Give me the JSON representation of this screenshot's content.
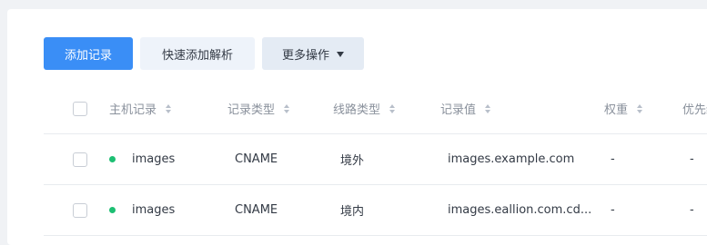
{
  "toolbar": {
    "add_label": "添加记录",
    "quick_add_label": "快速添加解析",
    "more_label": "更多操作"
  },
  "table": {
    "headers": {
      "host": "主机记录",
      "type": "记录类型",
      "line": "线路类型",
      "value": "记录值",
      "weight": "权重",
      "priority": "优先级"
    },
    "rows": [
      {
        "host": "images",
        "type": "CNAME",
        "line": "境外",
        "value": "images.example.com",
        "weight": "-",
        "priority": "-",
        "status_color": "#1dbf73"
      },
      {
        "host": "images",
        "type": "CNAME",
        "line": "境内",
        "value": "images.eallion.com.cd...",
        "weight": "-",
        "priority": "-",
        "status_color": "#1dbf73"
      }
    ]
  }
}
